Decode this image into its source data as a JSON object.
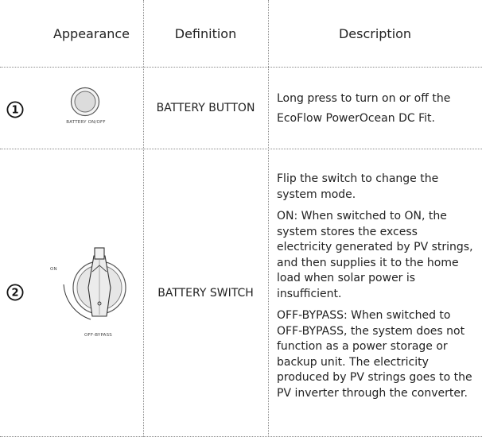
{
  "header": {
    "appearance": "Appearance",
    "definition": "Definition",
    "description": "Description"
  },
  "rows": [
    {
      "number": "1",
      "image_label": "BATTERY ON/OFF",
      "definition": "BATTERY BUTTON",
      "description": [
        "Long press to turn on or off the EcoFlow PowerOcean DC Fit."
      ]
    },
    {
      "number": "2",
      "image_label_on": "ON",
      "image_label_bypass": "OFF-BYPASS",
      "definition": "BATTERY SWITCH",
      "description_intro": "Flip the switch to change the system mode.",
      "on_label": "ON:",
      "on_text_1": " When switched to ",
      "on_word": "ON",
      "on_text_2": ", the system stores the excess electricity generated by PV strings, and then supplies it to the home load when solar power is insufficient.",
      "bypass_label": "OFF-BYPASS:",
      "bypass_text": " When switched to OFF-BYPASS, the system does not function as a power storage or backup unit. The electricity produced by PV strings goes to the PV inverter through the converter."
    }
  ]
}
